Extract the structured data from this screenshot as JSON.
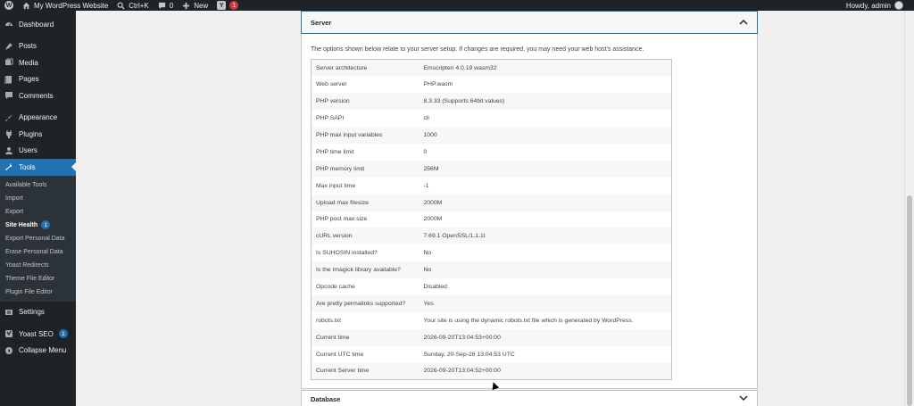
{
  "adminbar": {
    "site_name": "My WordPress Website",
    "search_shortcut": "Ctrl+K",
    "comments_count": "0",
    "new_label": "New",
    "yoast_count": "1",
    "howdy": "Howdy, admin"
  },
  "sidebar": {
    "items": [
      {
        "label": "Dashboard",
        "icon": "dashboard-icon"
      },
      {
        "label": "Posts",
        "icon": "pin-icon"
      },
      {
        "label": "Media",
        "icon": "media-icon"
      },
      {
        "label": "Pages",
        "icon": "pages-icon"
      },
      {
        "label": "Comments",
        "icon": "comment-icon"
      },
      {
        "label": "Appearance",
        "icon": "brush-icon"
      },
      {
        "label": "Plugins",
        "icon": "plugin-icon"
      },
      {
        "label": "Users",
        "icon": "user-icon"
      },
      {
        "label": "Tools",
        "icon": "wrench-icon"
      }
    ],
    "submenu": [
      "Available Tools",
      "Import",
      "Export",
      "Site Health",
      "Export Personal Data",
      "Erase Personal Data",
      "Yoast Redirects",
      "Theme File Editor",
      "Plugin File Editor"
    ],
    "site_health_count": "1",
    "settings_label": "Settings",
    "yoast_label": "Yoast SEO",
    "yoast_count": "1",
    "collapse_label": "Collapse Menu"
  },
  "server": {
    "title": "Server",
    "intro": "The options shown below relate to your server setup. If changes are required, you may need your web host's assistance.",
    "rows": [
      [
        "Server architecture",
        "Emscripten 4.0.19 wasm32"
      ],
      [
        "Web server",
        "PHP.wasm"
      ],
      [
        "PHP version",
        "8.3.33 (Supports 64bit values)"
      ],
      [
        "PHP SAPI",
        "cli"
      ],
      [
        "PHP max input variables",
        "1000"
      ],
      [
        "PHP time limit",
        "0"
      ],
      [
        "PHP memory limit",
        "256M"
      ],
      [
        "Max input time",
        "-1"
      ],
      [
        "Upload max filesize",
        "2000M"
      ],
      [
        "PHP post max size",
        "2000M"
      ],
      [
        "cURL version",
        "7.69.1 OpenSSL/1.1.1t"
      ],
      [
        "Is SUHOSIN installed?",
        "No"
      ],
      [
        "Is the Imagick library available?",
        "No"
      ],
      [
        "Opcode cache",
        "Disabled"
      ],
      [
        "Are pretty permalinks supported?",
        "Yes"
      ],
      [
        "robots.txt",
        "Your site is using the dynamic robots.txt file which is generated by WordPress."
      ],
      [
        "Current time",
        "2026-09-20T13:04:53+00:00"
      ],
      [
        "Current UTC time",
        "Sunday, 20-Sep-26 13:04:53 UTC"
      ],
      [
        "Current Server time",
        "2026-09-20T13:04:52+00:00"
      ]
    ]
  },
  "database": {
    "title": "Database"
  }
}
